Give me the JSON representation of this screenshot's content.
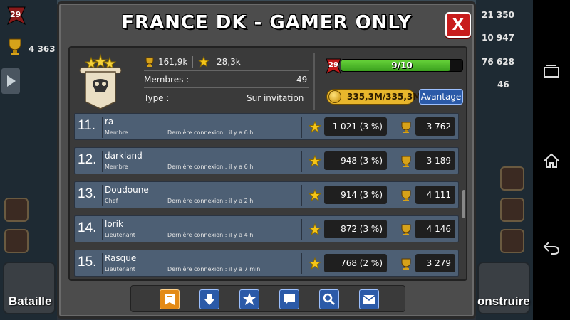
{
  "background": {
    "left_badge_value": "29",
    "left_trophy_value": "4 363",
    "right_values": [
      "21 350",
      "10 947",
      "76 628",
      "46"
    ],
    "battle_label": "Bataille",
    "build_label": "onstruire"
  },
  "modal": {
    "title": "FRANCE DK - GAMER ONLY",
    "close_label": "X"
  },
  "clan": {
    "trophies": "161,9k",
    "stars": "28,3k",
    "members_label": "Membres :",
    "members_value": "49",
    "type_label": "Type :",
    "type_value": "Sur invitation",
    "level": "29",
    "level_progress_text": "9/10",
    "level_progress": 0.9,
    "gold": "335,3M/335,3M",
    "advantage_label": "Avantage"
  },
  "members": [
    {
      "rank": "11.",
      "name": "ra",
      "role": "Membre",
      "last_login": "Dernière connexion : il y a 6 h",
      "stars": "1 021 (3 %)",
      "trophies": "3 762"
    },
    {
      "rank": "12.",
      "name": "darkland",
      "role": "Membre",
      "last_login": "Dernière connexion : il y a 6 h",
      "stars": "948 (3 %)",
      "trophies": "3 189"
    },
    {
      "rank": "13.",
      "name": "Doudoune",
      "role": "Chef",
      "last_login": "Dernière connexion : il y a 2 h",
      "stars": "914 (3 %)",
      "trophies": "4 111"
    },
    {
      "rank": "14.",
      "name": "lorik",
      "role": "Lieutenant",
      "last_login": "Dernière connexion : il y a 4 h",
      "stars": "872 (3 %)",
      "trophies": "4 146"
    },
    {
      "rank": "15.",
      "name": "Rasque",
      "role": "Lieutenant",
      "last_login": "Dernière connexion : il y a 7 min",
      "stars": "768 (2 %)",
      "trophies": "3 279"
    }
  ],
  "toolbar": {
    "buttons": [
      "banner-icon",
      "arrow-down-icon",
      "star-icon",
      "chat-icon",
      "search-icon",
      "mail-icon"
    ]
  },
  "colors": {
    "row": "#4d5f74",
    "accent_blue": "#2b5aa8",
    "active_orange": "#e38a16",
    "close_red": "#c81c1c",
    "level_green": "#3aa01e"
  }
}
